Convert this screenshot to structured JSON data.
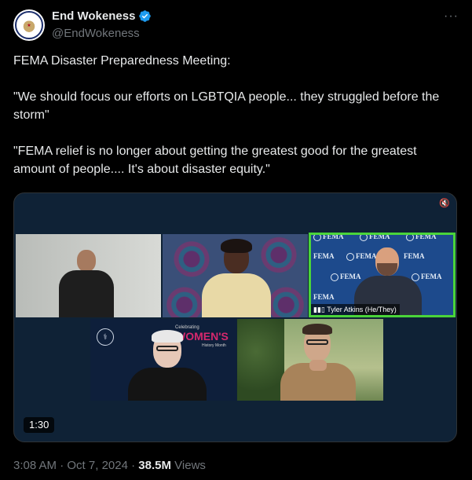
{
  "author": {
    "display_name": "End Wokeness",
    "handle": "@EndWokeness",
    "verified": true,
    "avatar_icon": "eagle-badge-icon"
  },
  "more_icon": "ellipsis-icon",
  "tweet": {
    "text": "FEMA Disaster Preparedness Meeting:\n\n\"We should focus our efforts on LGBTQIA people... they struggled before the storm\"\n\n\"FEMA relief is no longer about getting the greatest good for the greatest amount of people.... It's about disaster equity.\""
  },
  "video": {
    "duration": "1:30",
    "tiles": [
      {
        "name": "presenter"
      },
      {
        "name": "participant-woman"
      },
      {
        "name": "participant-tyler",
        "label": "Tyler  Atkins (He/They)",
        "active_speaker": true,
        "backdrop_text": "FEMA"
      },
      {
        "name": "participant-womens-month",
        "celebrating": "Celebrating",
        "womens": "WOMEN'S",
        "month": "History Month"
      },
      {
        "name": "participant-man-outdoors"
      }
    ]
  },
  "meta": {
    "time": "3:08 AM",
    "separator": "·",
    "date": "Oct 7, 2024",
    "views_count": "38.5M",
    "views_label": "Views"
  },
  "colors": {
    "accent_verified": "#1d9bf0",
    "active_speaker_border": "#4ad43a",
    "background": "#000000"
  }
}
